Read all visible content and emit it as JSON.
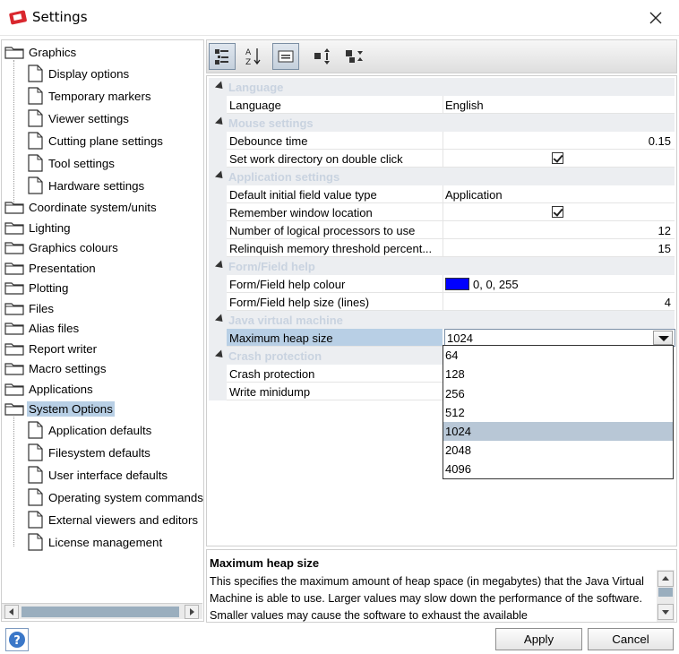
{
  "window": {
    "title": "Settings"
  },
  "tree": {
    "items": [
      {
        "label": "Graphics",
        "type": "folder"
      },
      {
        "label": "Display options",
        "type": "page"
      },
      {
        "label": "Temporary markers",
        "type": "page"
      },
      {
        "label": "Viewer settings",
        "type": "page"
      },
      {
        "label": "Cutting plane settings",
        "type": "page"
      },
      {
        "label": "Tool settings",
        "type": "page"
      },
      {
        "label": "Hardware settings",
        "type": "page"
      },
      {
        "label": "Coordinate system/units",
        "type": "folder"
      },
      {
        "label": "Lighting",
        "type": "folder"
      },
      {
        "label": "Graphics colours",
        "type": "folder"
      },
      {
        "label": "Presentation",
        "type": "folder"
      },
      {
        "label": "Plotting",
        "type": "folder"
      },
      {
        "label": "Files",
        "type": "folder"
      },
      {
        "label": "Alias files",
        "type": "folder"
      },
      {
        "label": "Report writer",
        "type": "folder"
      },
      {
        "label": "Macro settings",
        "type": "folder"
      },
      {
        "label": "Applications",
        "type": "folder"
      },
      {
        "label": "System Options",
        "type": "folder",
        "selected": true
      },
      {
        "label": "Application defaults",
        "type": "page"
      },
      {
        "label": "Filesystem defaults",
        "type": "page"
      },
      {
        "label": "User interface defaults",
        "type": "page"
      },
      {
        "label": "Operating system commands",
        "type": "page"
      },
      {
        "label": "External viewers and editors",
        "type": "page"
      },
      {
        "label": "License management",
        "type": "page"
      }
    ]
  },
  "toolbar": {
    "buttons": [
      {
        "icon": "categorized-icon",
        "pressed": true
      },
      {
        "icon": "sort-alphabetical-icon",
        "pressed": false
      },
      {
        "icon": "description-icon",
        "pressed": true
      },
      {
        "icon": "expand-all-icon",
        "pressed": false
      },
      {
        "icon": "collapse-all-icon",
        "pressed": false
      }
    ]
  },
  "properties": {
    "categories": {
      "language": "Language",
      "mouse": "Mouse settings",
      "application": "Application settings",
      "formhelp": "Form/Field help",
      "jvm": "Java virtual machine",
      "crash": "Crash protection"
    },
    "rows": {
      "language": {
        "name": "Language",
        "value": "English"
      },
      "debounce": {
        "name": "Debounce time",
        "value": "0.15"
      },
      "workdir": {
        "name": "Set work directory on double click",
        "checked": true
      },
      "fieldtype": {
        "name": "Default initial field value type",
        "value": "Application"
      },
      "remember": {
        "name": "Remember window location",
        "checked": true
      },
      "processors": {
        "name": "Number of logical processors to use",
        "value": "12"
      },
      "relinquish": {
        "name": "Relinquish memory threshold percent...",
        "value": "15"
      },
      "helpcolour": {
        "name": "Form/Field help colour",
        "value": "0, 0, 255",
        "color": "#0000ff"
      },
      "helpsize": {
        "name": "Form/Field help size (lines)",
        "value": "4"
      },
      "heap": {
        "name": "Maximum heap size",
        "value": "1024"
      },
      "crashprot": {
        "name": "Crash protection"
      },
      "minidump": {
        "name": "Write minidump"
      }
    }
  },
  "heap_dropdown": {
    "options": [
      "64",
      "128",
      "256",
      "512",
      "1024",
      "2048",
      "4096"
    ],
    "selected": "1024"
  },
  "help_pane": {
    "title": "Maximum heap size",
    "text": "This specifies the maximum amount of heap space (in megabytes) that the Java Virtual Machine is able to use.  Larger values may slow down the performance of the software.  Smaller values may cause the software to exhaust the available"
  },
  "buttons": {
    "apply": "Apply",
    "cancel": "Cancel"
  },
  "colors": {
    "selection": "#b8cfe5",
    "category_text": "#c9d3e0",
    "accent": "#0000ff"
  }
}
